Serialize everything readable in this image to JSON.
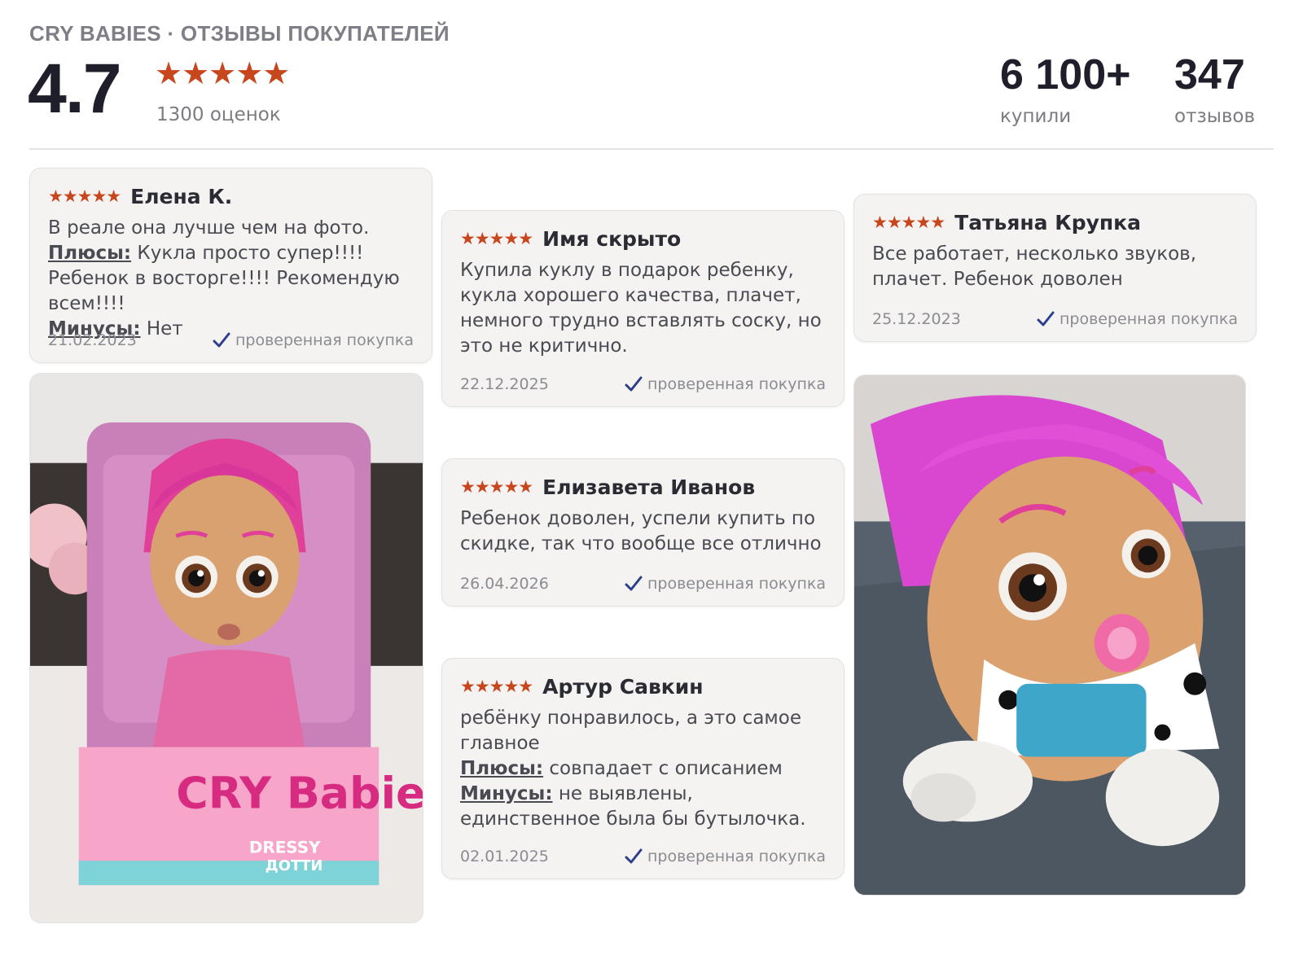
{
  "header": {
    "brand_line": "CRY BABIES · ОТЗЫВЫ ПОКУПАТЕЛЕЙ",
    "rating_value": "4.7",
    "stars": "★★★★★",
    "rating_count": "1300 оценок",
    "stats": [
      {
        "value": "6 100+",
        "label": "купили"
      },
      {
        "value": "347",
        "label": "отзывов"
      }
    ]
  },
  "reviews": [
    {
      "stars": "★★★★★",
      "author": "Елена К.",
      "text": "В реале она лучше чем на фото.",
      "pros_label": "Плюсы:",
      "pros": "Кукла просто супер!!!! Ребенок в восторге!!!! Рекомендую всем!!!!",
      "cons_label": "Минусы:",
      "cons": "Нет",
      "date": "21.02.2023",
      "verified": "проверенная покупка"
    },
    {
      "stars": "★★★★★",
      "author": "Имя скрыто",
      "text": "Купила куклу в подарок ребенку, кукла хорошего качества, плачет, немного трудно вставлять соску, но это не критично.",
      "date": "22.12.2025",
      "verified": "проверенная покупка"
    },
    {
      "stars": "★★★★★",
      "author": "Татьяна Крупка",
      "text": "Все работает, несколько звуков, плачет. Ребенок доволен",
      "date": "25.12.2023",
      "verified": "проверенная покупка"
    },
    {
      "stars": "★★★★★",
      "author": "Елизавета Иванов",
      "text": "Ребенок доволен, успели купить по скидке, так что вообще все отлично",
      "date": "26.04.2026",
      "verified": "проверенная покупка"
    },
    {
      "stars": "★★★★★",
      "author": "Артур Савкин",
      "text": "ребёнку понравилось, а это самое главное",
      "pros_label": "Плюсы:",
      "pros": "совпадает с описанием",
      "cons_label": "Минусы:",
      "cons": "не выявлены, единственное была бы бутылочка.",
      "date": "02.01.2025",
      "verified": "проверенная покупка"
    }
  ],
  "photos": [
    {
      "box_brand": "CRY Babies",
      "box_line": "DRESSY",
      "box_name": "ДОТТИ"
    },
    {}
  ],
  "colors": {
    "star": "#c8461d",
    "check": "#2c3f8c",
    "card_bg": "#f4f3f1"
  }
}
